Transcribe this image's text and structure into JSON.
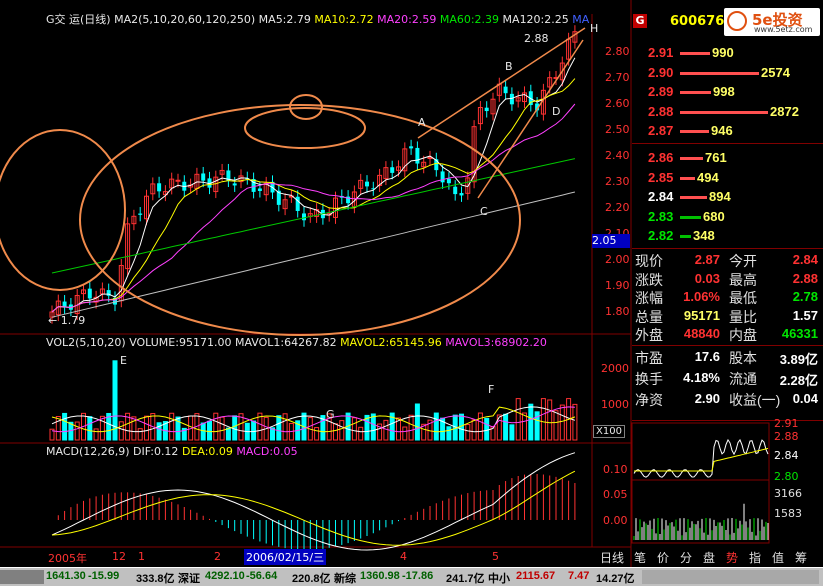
{
  "header": {
    "title": "G交 运(日线)",
    "ma_label": "MA2(5,10,20,60,120,250)",
    "ma5": "MA5:2.79",
    "ma10": "MA10:2.72",
    "ma20": "MA20:2.59",
    "ma60": "MA60:2.39",
    "ma120": "MA120:2.25",
    "ma_more": "MA"
  },
  "colors": {
    "up": "#ff3232",
    "down": "#00ffff",
    "ma5": "#ffffff",
    "ma10": "#ffff00",
    "ma20": "#ff40ff",
    "ma60": "#00c800",
    "ma120": "#c0c0c0",
    "annotation": "#f08a4b"
  },
  "price_axis": [
    "2.80",
    "2.70",
    "2.60",
    "2.50",
    "2.40",
    "2.30",
    "2.20",
    "2.10",
    "2.00",
    "1.90",
    "1.80"
  ],
  "price_tag": "2.05",
  "annotations": {
    "high": "2.88",
    "low": "← 1.79",
    "points": [
      "A",
      "B",
      "C",
      "D",
      "H",
      "E",
      "F",
      "G"
    ]
  },
  "volume": {
    "label": "VOL2(5,10,20)",
    "volume": "VOLUME:95171.00",
    "mavol1": "MAVOL1:64267.82",
    "mavol2": "MAVOL2:65145.96",
    "mavol3": "MAVOL3:68902.20",
    "axis": [
      "2000",
      "1000"
    ],
    "unit": "X100"
  },
  "macd": {
    "label": "MACD(12,26,9)",
    "dif": "DIF:0.12",
    "dea": "DEA:0.09",
    "macd": "MACD:0.05",
    "axis": [
      "0.10",
      "0.05",
      "0.00"
    ]
  },
  "date_axis": {
    "labels": [
      "2005年",
      "12",
      "1",
      "2",
      "4",
      "5"
    ],
    "cursor_date": "2006/02/15/三"
  },
  "quote": {
    "logo_badge": "G",
    "code": "600676",
    "brand": "5e投资",
    "brand_url": "www.5etz.com",
    "sell": [
      {
        "price": "2.91",
        "vol": "990"
      },
      {
        "price": "2.90",
        "vol": "2574"
      },
      {
        "price": "2.89",
        "vol": "998"
      },
      {
        "price": "2.88",
        "vol": "2872"
      },
      {
        "price": "2.87",
        "vol": "946"
      }
    ],
    "buy": [
      {
        "price": "2.86",
        "vol": "761"
      },
      {
        "price": "2.85",
        "vol": "494"
      },
      {
        "price": "2.84",
        "vol": "894"
      },
      {
        "price": "2.83",
        "vol": "680"
      },
      {
        "price": "2.82",
        "vol": "348"
      }
    ],
    "stats": [
      {
        "l1": "现价",
        "v1": "2.87",
        "l2": "今开",
        "v2": "2.84"
      },
      {
        "l1": "涨跌",
        "v1": "0.03",
        "l2": "最高",
        "v2": "2.88"
      },
      {
        "l1": "涨幅",
        "v1": "1.06%",
        "l2": "最低",
        "v2": "2.78"
      },
      {
        "l1": "总量",
        "v1": "95171",
        "l2": "量比",
        "v2": "1.57"
      },
      {
        "l1": "外盘",
        "v1": "48840",
        "l2": "内盘",
        "v2": "46331"
      }
    ],
    "stats2": [
      {
        "l1": "市盈",
        "v1": "17.6",
        "l2": "股本",
        "v2": "3.89亿"
      },
      {
        "l1": "换手",
        "v1": "4.18%",
        "l2": "流通",
        "v2": "2.28亿"
      },
      {
        "l1": "净资",
        "v1": "2.90",
        "l2": "收益(一)",
        "v2": "0.04"
      }
    ],
    "mini_axis": [
      "2.91",
      "2.88",
      "2.84",
      "2.80",
      "3166",
      "1583"
    ]
  },
  "tabs": [
    "日线",
    "笔",
    "价",
    "分",
    "盘",
    "势",
    "指",
    "值",
    "筹"
  ],
  "status_bar": {
    "idx1_val": "1641.30",
    "idx1_chg": "-15.99",
    "idx1_amt": "333.8亿",
    "idx2_name": "深证",
    "idx2_val": "4292.10",
    "idx2_chg": "-56.64",
    "idx2_amt": "220.8亿",
    "idx3_name": "新综",
    "idx3_val": "1360.98",
    "idx3_chg": "-17.86",
    "idx3_amt": "241.7亿",
    "idx4_name": "中小",
    "idx4_val": "2115.67",
    "idx4_chg": "7.47",
    "idx4_amt": "14.27亿"
  }
}
